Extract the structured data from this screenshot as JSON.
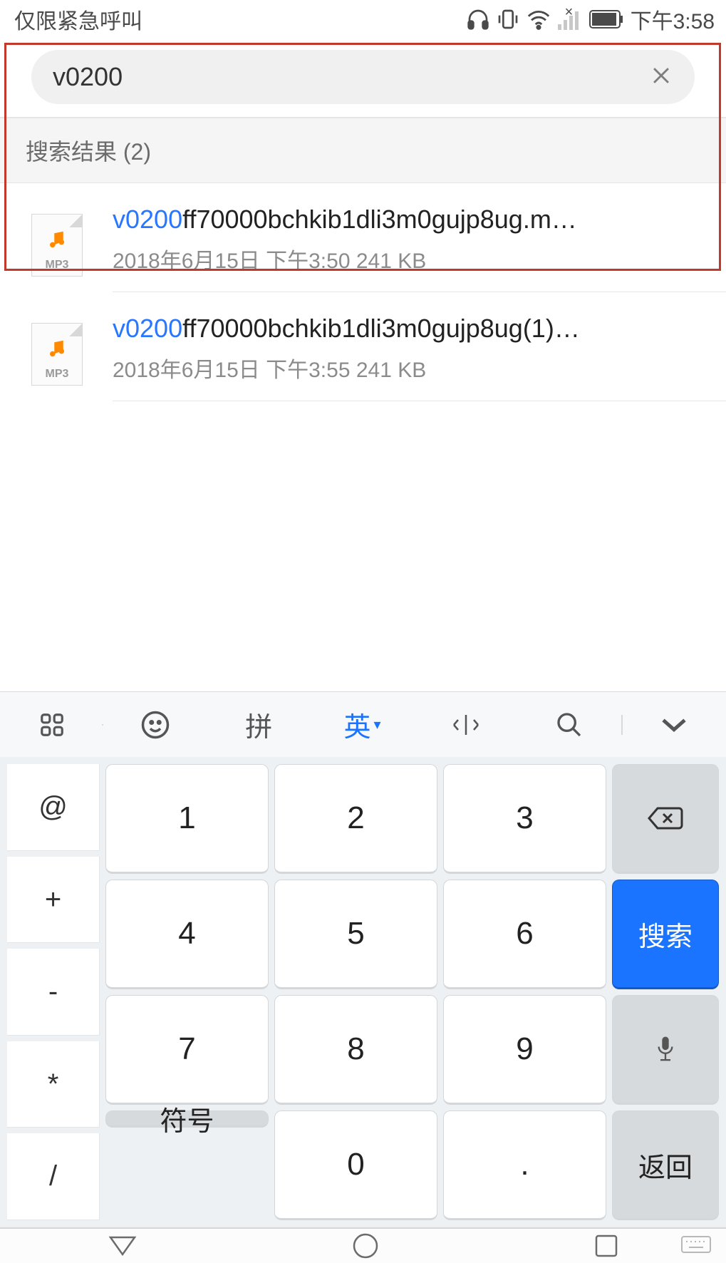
{
  "status": {
    "carrier": "仅限紧急呼叫",
    "time": "下午3:58"
  },
  "search": {
    "value": "v0200"
  },
  "results": {
    "header": "搜索结果 (2)",
    "items": [
      {
        "highlight": "v0200",
        "rest": "ff70000bchkib1dli3m0gujp8ug.m…",
        "ext": "MP3",
        "meta": "2018年6月15日 下午3:50 241 KB"
      },
      {
        "highlight": "v0200",
        "rest": "ff70000bchkib1dli3m0gujp8ug(1)…",
        "ext": "MP3",
        "meta": "2018年6月15日 下午3:55 241 KB"
      }
    ]
  },
  "keyboard": {
    "top": {
      "pinyin": "拼",
      "english": "英",
      "collapse": ""
    },
    "side_left": [
      "@",
      "+",
      "-",
      "*",
      "/"
    ],
    "numpad": [
      [
        "1",
        "2",
        "3"
      ],
      [
        "4",
        "5",
        "6"
      ],
      [
        "7",
        "8",
        "9"
      ],
      [
        "符号",
        "0",
        "."
      ]
    ],
    "action": "搜索",
    "back": "返回"
  }
}
